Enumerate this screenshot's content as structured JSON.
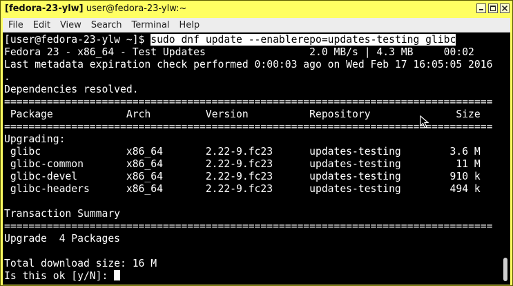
{
  "window": {
    "title_bold": "[fedora-23-ylw]",
    "title_rest": " user@fedora-23-ylw:~"
  },
  "menu": {
    "items": [
      {
        "label": "File"
      },
      {
        "label": "Edit"
      },
      {
        "label": "View"
      },
      {
        "label": "Search"
      },
      {
        "label": "Terminal"
      },
      {
        "label": "Help"
      }
    ]
  },
  "terminal": {
    "prompt": "[user@fedora-23-ylw ~]$ ",
    "command": "sudo dnf update --enablerepo=updates-testing glibc",
    "lines": [
      "Fedora 23 - x86_64 - Test Updates                 2.0 MB/s | 4.3 MB     00:02",
      "Last metadata expiration check performed 0:00:03 ago on Wed Feb 17 16:05:05 2016",
      ".",
      "Dependencies resolved.",
      "================================================================================",
      " Package            Arch         Version          Repository              Size",
      "================================================================================",
      "Upgrading:",
      " glibc              x86_64       2.22-9.fc23      updates-testing        3.6 M",
      " glibc-common       x86_64       2.22-9.fc23      updates-testing         11 M",
      " glibc-devel        x86_64       2.22-9.fc23      updates-testing        910 k",
      " glibc-headers      x86_64       2.22-9.fc23      updates-testing        494 k",
      "",
      "Transaction Summary",
      "================================================================================",
      "Upgrade  4 Packages",
      "",
      "Total download size: 16 M"
    ],
    "final_prompt": "Is this ok [y/N]: "
  },
  "colors": {
    "window_frame": "#ffff62",
    "terminal_bg": "#000000",
    "terminal_fg": "#ffffff"
  }
}
